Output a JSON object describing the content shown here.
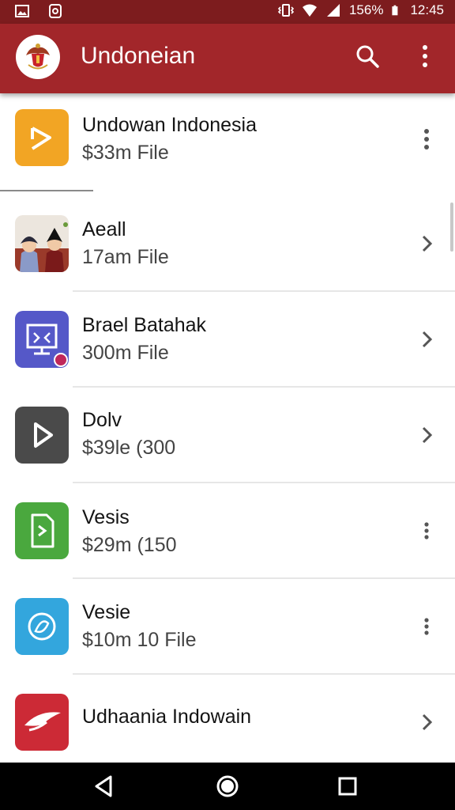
{
  "status_bar": {
    "battery_percent": "156%",
    "time": "12:45",
    "icons": [
      "image-icon",
      "app-icon",
      "vibrate-icon",
      "wifi-icon",
      "signal-icon",
      "battery-icon"
    ]
  },
  "app_bar": {
    "title": "Undoneian",
    "icons": [
      "emblem-logo",
      "search-icon",
      "more-vert-icon"
    ],
    "color": "#a2262a"
  },
  "items": [
    {
      "title": "Undowan Indonesia",
      "subtitle": "$33m File",
      "trailing": "more-vert-icon",
      "icon": "play-icon",
      "color": "#f2a524"
    },
    {
      "title": "Aeall",
      "subtitle": "17am File",
      "trailing": "chevron-right-icon",
      "icon": "people-illustration-icon",
      "color": "#e8e2da"
    },
    {
      "title": "Brael Batahak",
      "subtitle": "300m File",
      "trailing": "chevron-right-icon",
      "icon": "presentation-icon",
      "color": "#5558c8"
    },
    {
      "title": "Dolv",
      "subtitle": "$39le (300",
      "trailing": "chevron-right-icon",
      "icon": "play-icon",
      "color": "#4a4a4a"
    },
    {
      "title": "Vesis",
      "subtitle": "$29m (150",
      "trailing": "more-vert-icon",
      "icon": "document-icon",
      "color": "#4aa83e"
    },
    {
      "title": "Vesie",
      "subtitle": "$10m 10 File",
      "trailing": "more-vert-icon",
      "icon": "circle-chat-icon",
      "color": "#33a6dd"
    },
    {
      "title": "Udhaania Indowain",
      "subtitle": "",
      "trailing": "chevron-right-icon",
      "icon": "wing-icon",
      "color": "#cc2a36"
    }
  ],
  "nav_bar": {
    "icons": [
      "back-icon",
      "home-icon",
      "recents-icon"
    ]
  }
}
